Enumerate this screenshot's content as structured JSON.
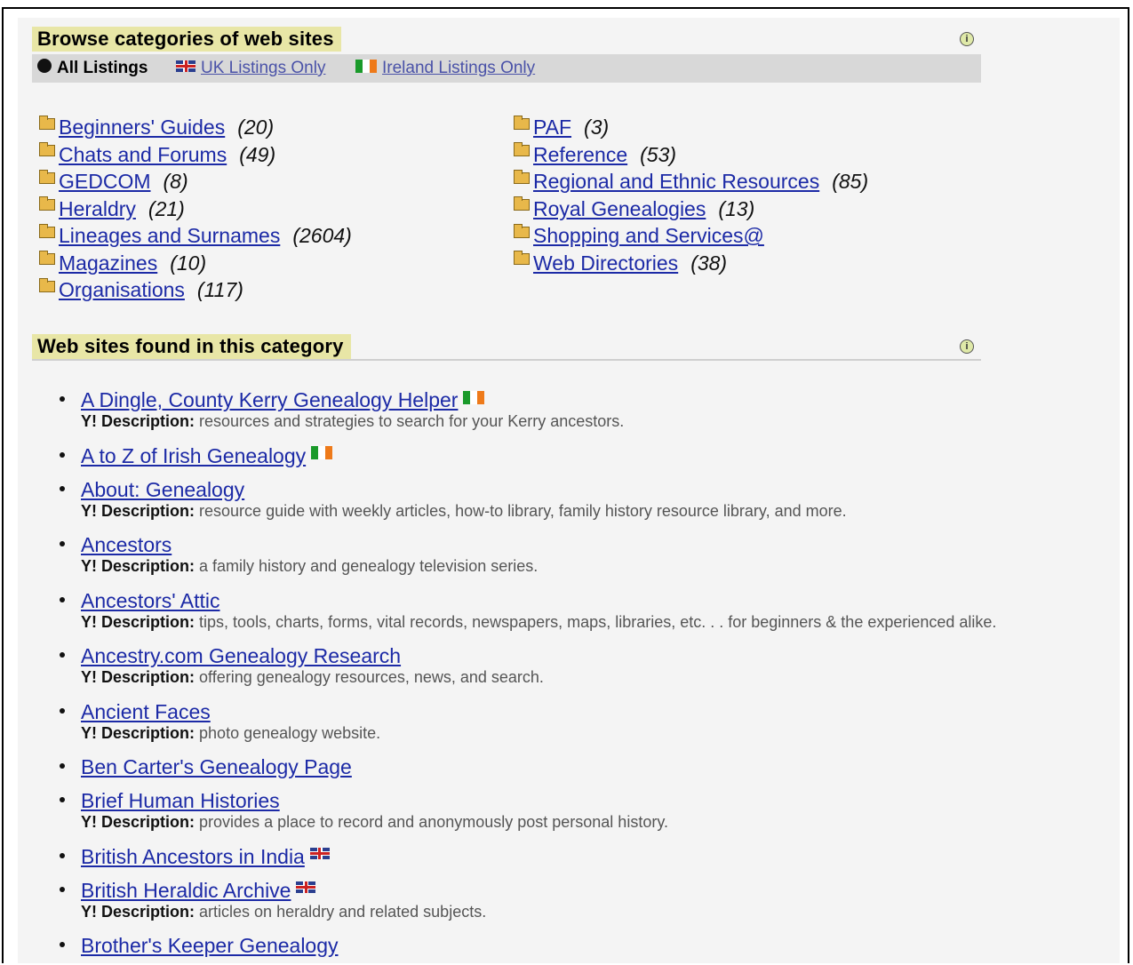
{
  "browse": {
    "title": "Browse categories of web sites",
    "filters": {
      "all": "All Listings",
      "uk": "UK Listings Only",
      "ireland": "Ireland Listings Only"
    }
  },
  "categories_left": [
    {
      "name": "Beginners' Guides",
      "count": "(20)"
    },
    {
      "name": "Chats and Forums",
      "count": "(49)"
    },
    {
      "name": "GEDCOM",
      "count": "(8)"
    },
    {
      "name": "Heraldry",
      "count": "(21)"
    },
    {
      "name": "Lineages and Surnames",
      "count": "(2604)"
    },
    {
      "name": "Magazines",
      "count": "(10)"
    },
    {
      "name": "Organisations",
      "count": "(117)"
    }
  ],
  "categories_right": [
    {
      "name": "PAF",
      "count": "(3)"
    },
    {
      "name": "Reference",
      "count": "(53)"
    },
    {
      "name": "Regional and Ethnic Resources",
      "count": "(85)"
    },
    {
      "name": "Royal Genealogies",
      "count": "(13)"
    },
    {
      "name": "Shopping and Services@",
      "count": ""
    },
    {
      "name": "Web Directories",
      "count": "(38)"
    }
  ],
  "sites_section": {
    "title": "Web sites found in this category",
    "desc_label": "Y! Description:"
  },
  "sites": [
    {
      "title": "A Dingle, County Kerry Genealogy Helper",
      "flag": "ireland",
      "desc": "resources and strategies to search for your Kerry ancestors."
    },
    {
      "title": "A to Z of Irish Genealogy",
      "flag": "ireland",
      "desc": ""
    },
    {
      "title": "About: Genealogy",
      "flag": "",
      "desc": "resource guide with weekly articles, how-to library, family history resource library, and more."
    },
    {
      "title": "Ancestors",
      "flag": "",
      "desc": "a family history and genealogy television series."
    },
    {
      "title": "Ancestors' Attic",
      "flag": "",
      "desc": "tips, tools, charts, forms, vital records, newspapers, maps, libraries, etc. . . for beginners & the experienced alike."
    },
    {
      "title": "Ancestry.com Genealogy Research",
      "flag": "",
      "desc": "offering genealogy resources, news, and search."
    },
    {
      "title": "Ancient Faces",
      "flag": "",
      "desc": "photo genealogy website."
    },
    {
      "title": "Ben Carter's Genealogy Page",
      "flag": "",
      "desc": ""
    },
    {
      "title": "Brief Human Histories",
      "flag": "",
      "desc": "provides a place to record and anonymously post personal history."
    },
    {
      "title": "British Ancestors in India",
      "flag": "uk",
      "desc": ""
    },
    {
      "title": "British Heraldic Archive",
      "flag": "uk",
      "desc": "articles on heraldry and related subjects."
    },
    {
      "title": "Brother's Keeper Genealogy",
      "flag": "",
      "desc": ""
    }
  ]
}
